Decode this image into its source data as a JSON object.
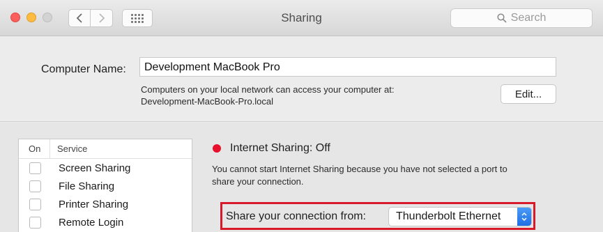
{
  "window": {
    "title": "Sharing",
    "search_placeholder": "Search"
  },
  "computer_name": {
    "label": "Computer Name:",
    "value": "Development MacBook Pro",
    "description_line1": "Computers on your local network can access your computer at:",
    "description_line2": "Development-MacBook-Pro.local",
    "edit_label": "Edit..."
  },
  "services": {
    "header_on": "On",
    "header_service": "Service",
    "items": [
      {
        "label": "Screen Sharing",
        "checked": false
      },
      {
        "label": "File Sharing",
        "checked": false
      },
      {
        "label": "Printer Sharing",
        "checked": false
      },
      {
        "label": "Remote Login",
        "checked": false
      }
    ]
  },
  "internet_sharing": {
    "status": "Internet Sharing: Off",
    "status_color": "#e8112d",
    "info_line1": "You cannot start Internet Sharing because you have not selected a port to",
    "info_line2": "share your connection.",
    "share_from_label": "Share your connection from:",
    "share_from_value": "Thunderbolt Ethernet",
    "highlight_color": "#d7192a"
  },
  "icons": [
    "back-icon",
    "forward-icon",
    "grid-icon",
    "search-icon",
    "select-arrows-icon"
  ]
}
